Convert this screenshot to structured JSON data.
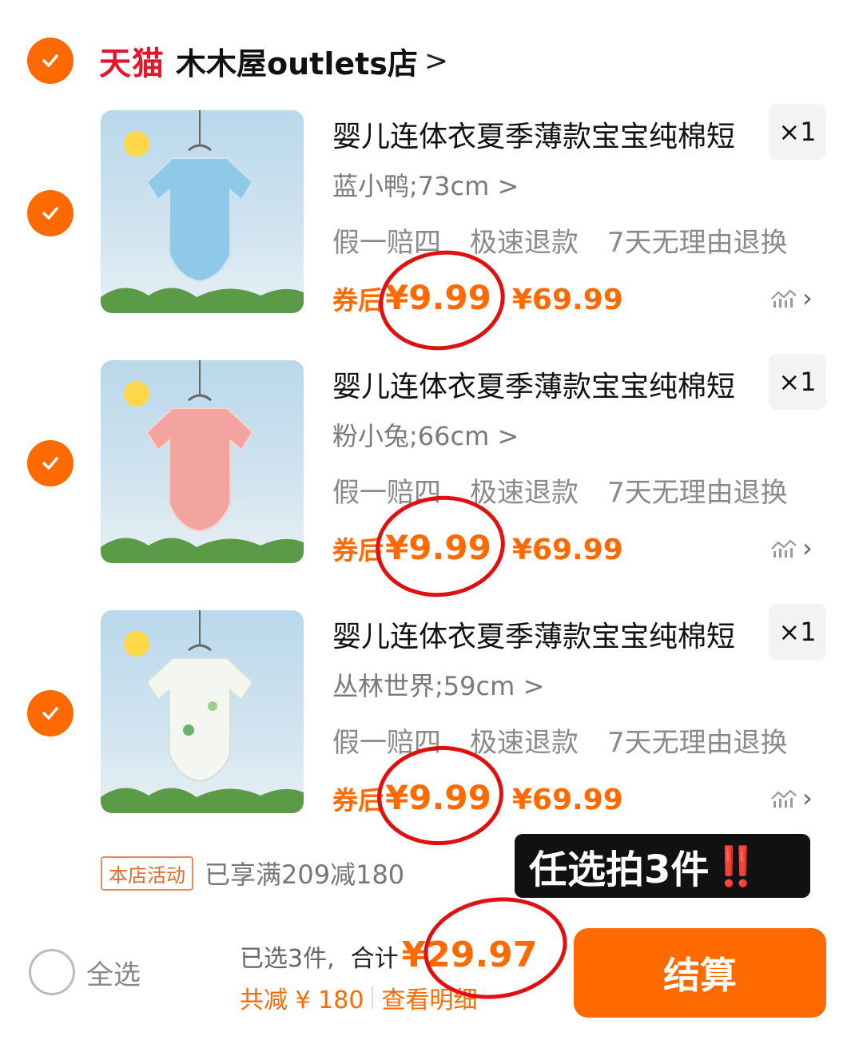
{
  "shop": {
    "platform": "天猫",
    "name": "木木屋outlets店",
    "chevron": ">"
  },
  "items": [
    {
      "title": "婴儿连体衣夏季薄款宝宝纯棉短",
      "qty": "×1",
      "sku": "蓝小鸭;73cm >",
      "tags": [
        "假一赔四",
        "极速退款",
        "7天无理由退换"
      ],
      "coupon_label": "券后",
      "price_now": "¥9.99",
      "price_orig": "¥69.99",
      "garment_color": "#8ec9ea"
    },
    {
      "title": "婴儿连体衣夏季薄款宝宝纯棉短",
      "qty": "×1",
      "sku": "粉小兔;66cm >",
      "tags": [
        "假一赔四",
        "极速退款",
        "7天无理由退换"
      ],
      "coupon_label": "券后",
      "price_now": "¥9.99",
      "price_orig": "¥69.99",
      "garment_color": "#f3a3a0"
    },
    {
      "title": "婴儿连体衣夏季薄款宝宝纯棉短",
      "qty": "×1",
      "sku": "丛林世界;59cm >",
      "tags": [
        "假一赔四",
        "极速退款",
        "7天无理由退换"
      ],
      "coupon_label": "券后",
      "price_now": "¥9.99",
      "price_orig": "¥69.99",
      "garment_color": "#f4f6f1"
    }
  ],
  "promo": {
    "badge": "本店活动",
    "text": "已享满209减180"
  },
  "overlay": {
    "text": "任选拍3件",
    "emphasis": "‼️"
  },
  "footer": {
    "select_all": "全选",
    "selected": "已选3件,",
    "total_label": "合计",
    "total": "¥29.97",
    "discount": "共减 ¥ 180",
    "details": "查看明细"
  },
  "colors": {
    "accent": "#ff6a00",
    "tmall": "#e0182d",
    "annotation": "#e01010"
  }
}
